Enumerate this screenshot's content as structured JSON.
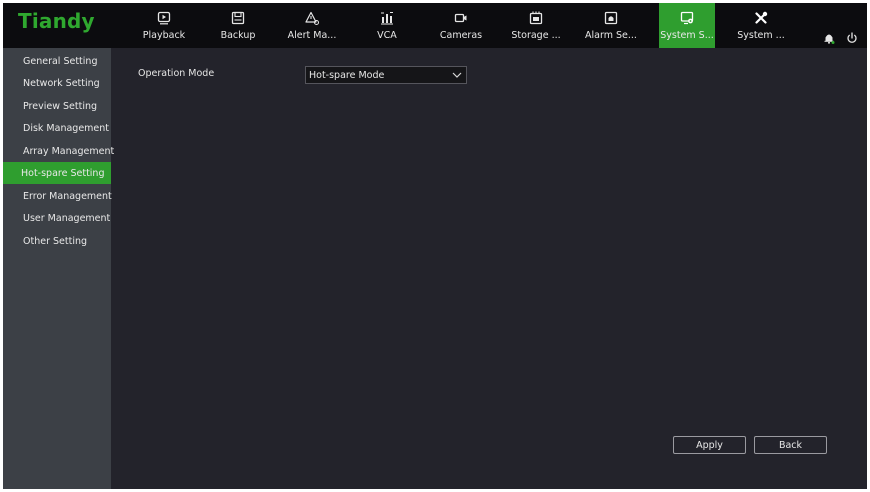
{
  "brand": {
    "name": "Tiandy",
    "color": "#2fa82f"
  },
  "nav": [
    {
      "label": "Playback",
      "icon": "playback-icon"
    },
    {
      "label": "Backup",
      "icon": "backup-icon"
    },
    {
      "label": "Alert Ma...",
      "icon": "alert-icon"
    },
    {
      "label": "VCA",
      "icon": "vca-icon"
    },
    {
      "label": "Cameras",
      "icon": "camera-icon"
    },
    {
      "label": "Storage ...",
      "icon": "storage-icon"
    },
    {
      "label": "Alarm Se...",
      "icon": "alarm-icon"
    },
    {
      "label": "System S...",
      "icon": "system-settings-icon",
      "active": true
    },
    {
      "label": "System ...",
      "icon": "tools-icon"
    }
  ],
  "top_icons": [
    "bell-icon",
    "power-icon"
  ],
  "sidebar": {
    "items": [
      {
        "label": "General Setting"
      },
      {
        "label": "Network Setting"
      },
      {
        "label": "Preview Setting"
      },
      {
        "label": "Disk Management"
      },
      {
        "label": "Array Management"
      },
      {
        "label": "Hot-spare Setting",
        "active": true
      },
      {
        "label": "Error Management"
      },
      {
        "label": "User Management"
      },
      {
        "label": "Other Setting"
      }
    ]
  },
  "form": {
    "operation_mode_label": "Operation Mode",
    "operation_mode_value": "Hot-spare Mode"
  },
  "buttons": {
    "apply": "Apply",
    "back": "Back"
  },
  "colors": {
    "accent": "#2f9e2f",
    "sidebar": "#3c4046",
    "background": "#23232b",
    "topbar": "#0c0c0f"
  }
}
